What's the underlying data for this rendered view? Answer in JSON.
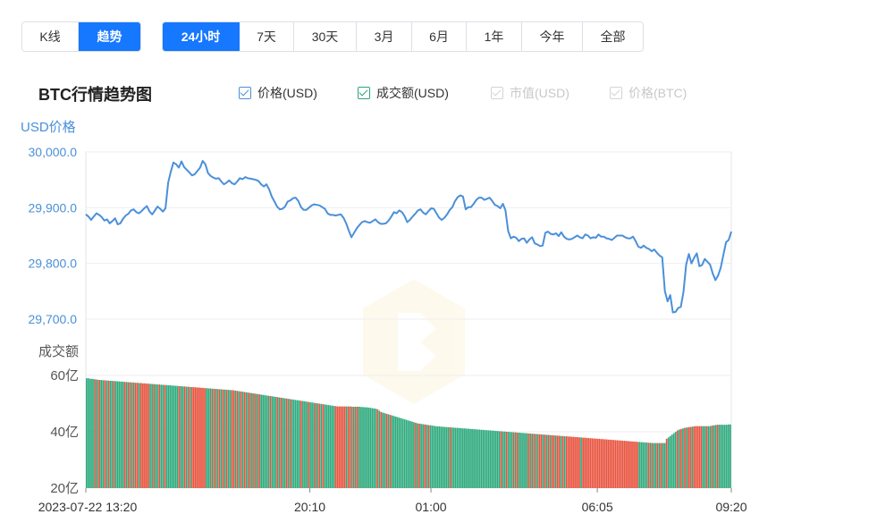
{
  "mode_tabs": [
    {
      "label": "K线",
      "active": false
    },
    {
      "label": "趋势",
      "active": true
    }
  ],
  "range_tabs": [
    {
      "label": "24小时",
      "active": true
    },
    {
      "label": "7天",
      "active": false
    },
    {
      "label": "30天",
      "active": false
    },
    {
      "label": "3月",
      "active": false
    },
    {
      "label": "6月",
      "active": false
    },
    {
      "label": "1年",
      "active": false
    },
    {
      "label": "今年",
      "active": false
    },
    {
      "label": "全部",
      "active": false
    }
  ],
  "title": "BTC行情趋势图",
  "legend": [
    {
      "label": "价格(USD)",
      "checked": true,
      "color": "#4a90d9"
    },
    {
      "label": "成交额(USD)",
      "checked": true,
      "color": "#2ea37a"
    },
    {
      "label": "市值(USD)",
      "checked": false,
      "color": "#cccccc"
    },
    {
      "label": "价格(BTC)",
      "checked": false,
      "color": "#cccccc"
    }
  ],
  "colors": {
    "accent": "#1677ff",
    "price_line": "#4a90d9",
    "volume_up": "#2eaa7d",
    "volume_down": "#e8533f",
    "grid": "#eeeeee",
    "axis_label": "#4a90d9"
  },
  "chart_data": {
    "type": "line",
    "price": {
      "ylabel": "USD价格",
      "ylim": [
        29700,
        30000
      ],
      "yticks": [
        "30,000.0",
        "29,900.0",
        "29,800.0",
        "29,700.0"
      ],
      "ytick_values": [
        30000,
        29900,
        29800,
        29700
      ],
      "values": [
        29888,
        29884,
        29878,
        29884,
        29890,
        29887,
        29883,
        29877,
        29879,
        29872,
        29876,
        29881,
        29870,
        29872,
        29880,
        29886,
        29889,
        29895,
        29897,
        29892,
        29890,
        29894,
        29899,
        29903,
        29893,
        29888,
        29895,
        29902,
        29898,
        29893,
        29899,
        29945,
        29965,
        29981,
        29978,
        29972,
        29983,
        29973,
        29968,
        29963,
        29958,
        29960,
        29966,
        29972,
        29984,
        29978,
        29962,
        29957,
        29954,
        29952,
        29953,
        29947,
        29942,
        29945,
        29949,
        29944,
        29942,
        29947,
        29953,
        29951,
        29955,
        29953,
        29952,
        29951,
        29950,
        29948,
        29942,
        29938,
        29942,
        29933,
        29920,
        29911,
        29902,
        29897,
        29898,
        29902,
        29911,
        29913,
        29917,
        29918,
        29912,
        29901,
        29896,
        29896,
        29900,
        29904,
        29906,
        29905,
        29904,
        29901,
        29898,
        29890,
        29887,
        29887,
        29886,
        29887,
        29888,
        29882,
        29872,
        29859,
        29847,
        29855,
        29863,
        29869,
        29874,
        29876,
        29874,
        29873,
        29876,
        29879,
        29874,
        29871,
        29871,
        29872,
        29877,
        29884,
        29892,
        29890,
        29895,
        29892,
        29885,
        29874,
        29878,
        29884,
        29889,
        29895,
        29897,
        29891,
        29888,
        29894,
        29899,
        29898,
        29890,
        29882,
        29878,
        29882,
        29888,
        29896,
        29901,
        29912,
        29919,
        29922,
        29920,
        29897,
        29901,
        29901,
        29907,
        29914,
        29918,
        29918,
        29914,
        29916,
        29918,
        29912,
        29905,
        29903,
        29899,
        29907,
        29895,
        29858,
        29845,
        29848,
        29846,
        29840,
        29844,
        29845,
        29837,
        29843,
        29847,
        29836,
        29834,
        29831,
        29832,
        29855,
        29857,
        29853,
        29852,
        29854,
        29849,
        29856,
        29848,
        29844,
        29843,
        29844,
        29847,
        29850,
        29847,
        29845,
        29852,
        29850,
        29845,
        29847,
        29846,
        29852,
        29848,
        29848,
        29845,
        29844,
        29842,
        29846,
        29850,
        29850,
        29850,
        29847,
        29845,
        29845,
        29848,
        29840,
        29830,
        29828,
        29832,
        29828,
        29826,
        29822,
        29825,
        29819,
        29814,
        29811,
        29750,
        29732,
        29743,
        29712,
        29713,
        29720,
        29722,
        29749,
        29798,
        29817,
        29800,
        29810,
        29818,
        29795,
        29797,
        29808,
        29803,
        29798,
        29782,
        29770,
        29778,
        29792,
        29815,
        29838,
        29842,
        29857
      ]
    },
    "volume": {
      "ylabel": "成交额",
      "ylim": [
        20,
        60
      ],
      "yticks": [
        "60亿",
        "40亿",
        "20亿"
      ],
      "ytick_values": [
        60,
        40,
        20
      ],
      "values": [
        59,
        59,
        58.8,
        58.8,
        58.7,
        58.6,
        58.5,
        58.4,
        58.4,
        58.3,
        58.3,
        58.2,
        58.2,
        58.1,
        58.1,
        58,
        58,
        57.9,
        57.9,
        57.8,
        57.8,
        57.7,
        57.7,
        57.6,
        57.6,
        57.5,
        57.5,
        57.4,
        57.4,
        57.3,
        57.3,
        57.2,
        57.2,
        57.1,
        57.1,
        57,
        57,
        56.9,
        56.9,
        56.8,
        56.8,
        56.7,
        56.7,
        56.6,
        56.6,
        56.5,
        56.5,
        56.4,
        56.4,
        56.3,
        56.3,
        56.2,
        56.2,
        56.1,
        56.1,
        56,
        56,
        55.9,
        55.9,
        55.8,
        55.8,
        55.7,
        55.7,
        55.6,
        55.6,
        55.5,
        55.5,
        55.4,
        55.4,
        55.3,
        55.3,
        55.2,
        55.2,
        55.1,
        55.1,
        55,
        55,
        54.9,
        54.9,
        54.8,
        54.8,
        54.7,
        54.6,
        54.5,
        54.4,
        54.3,
        54.2,
        54.1,
        54,
        53.9,
        53.8,
        53.7,
        53.6,
        53.5,
        53.4,
        53.3,
        53.2,
        53.1,
        53,
        52.9,
        52.8,
        52.7,
        52.6,
        52.5,
        52.4,
        52.3,
        52.2,
        52.1,
        52,
        51.9,
        51.8,
        51.7,
        51.6,
        51.5,
        51.4,
        51.3,
        51.2,
        51.1,
        51,
        50.9,
        50.8,
        50.7,
        50.6,
        50.5,
        50.4,
        50.3,
        50.2,
        50.1,
        50,
        49.9,
        49.8,
        49.7,
        49.6,
        49.5,
        49.4,
        49.3,
        49.2,
        49.1,
        49,
        49,
        49,
        49,
        49,
        49,
        49,
        49,
        48.9,
        48.9,
        48.9,
        48.9,
        48.9,
        48.8,
        48.8,
        48.7,
        48.7,
        48.6,
        48.5,
        48.4,
        48.3,
        48.2,
        48,
        47.5,
        47,
        46.8,
        46.6,
        46.4,
        46.2,
        46,
        45.8,
        45.6,
        45.4,
        45.2,
        45,
        44.8,
        44.6,
        44.4,
        44.2,
        44,
        43.8,
        43.6,
        43.4,
        43.2,
        43,
        42.9,
        42.8,
        42.7,
        42.6,
        42.5,
        42.4,
        42.3,
        42.2,
        42.1,
        42,
        41.9,
        41.9,
        41.8,
        41.8,
        41.7,
        41.7,
        41.6,
        41.6,
        41.5,
        41.5,
        41.4,
        41.4,
        41.3,
        41.3,
        41.2,
        41.2,
        41.1,
        41.1,
        41,
        41,
        40.9,
        40.9,
        40.8,
        40.8,
        40.7,
        40.7,
        40.6,
        40.6,
        40.5,
        40.5,
        40.4,
        40.4,
        40.3,
        40.3,
        40.2,
        40.2,
        40.1,
        40.1,
        40,
        40,
        39.9,
        39.9,
        39.8,
        39.8,
        39.7,
        39.7,
        39.6,
        39.6,
        39.5,
        39.5,
        39.4,
        39.4,
        39.3,
        39.3,
        39.2,
        39.2,
        39.1,
        39.1,
        39,
        39,
        38.9,
        38.9,
        38.8,
        38.8,
        38.7,
        38.7,
        38.6,
        38.6,
        38.5,
        38.5,
        38.4,
        38.4,
        38.3,
        38.3,
        38.2,
        38.2,
        38.1,
        38.1,
        38,
        38,
        37.9,
        37.9,
        37.8,
        37.8,
        37.7,
        37.7,
        37.6,
        37.6,
        37.5,
        37.5,
        37.4,
        37.4,
        37.3,
        37.3,
        37.2,
        37.2,
        37.1,
        37.1,
        37,
        37,
        36.9,
        36.9,
        36.8,
        36.8,
        36.7,
        36.7,
        36.6,
        36.6,
        36.5,
        36.5,
        36.4,
        36.4,
        36.3,
        36.3,
        36.2,
        36.2,
        36.1,
        36.1,
        36,
        36,
        36,
        36,
        36,
        36,
        36,
        36,
        37.5,
        38,
        38.5,
        39,
        39.5,
        40,
        40.5,
        40.8,
        41,
        41.2,
        41.4,
        41.5,
        41.6,
        41.7,
        41.8,
        41.9,
        42,
        42,
        42,
        42,
        42,
        42,
        42,
        42,
        42,
        42.2,
        42.3,
        42.4,
        42.5,
        42.5,
        42.5,
        42.5,
        42.5,
        42.5,
        42.6,
        42.6
      ],
      "colors": "gggggrgrggrgrggrgggggrgrgrgrrgrrrrrggrggrggrgggggggrggrgrgrrrrrrrrgggrgrgrgrgrggrrgrgrgrgrgrgrgrgggggrgggrgrggrgrgggggrgggrgggrgrgrggggggrrrrrrgrrgrgrggggggggggrgrggrgrgggggggggggggrgrggrgrgggggggggggrgggggggggggggggggggggggggggrggrgggrgrgggggrgrgrgrrgrgrgrrgrrgrgrrrrrrrrgrrrrrrrrrrrrrrrrrrrrrrrrrrrrrrr"
    },
    "x_ticks": [
      "2023-07-22 13:20",
      "20:10",
      "01:00",
      "06:05",
      "09:20"
    ],
    "x_tick_positions": [
      0,
      0.347,
      0.5347,
      0.7924,
      1
    ]
  }
}
